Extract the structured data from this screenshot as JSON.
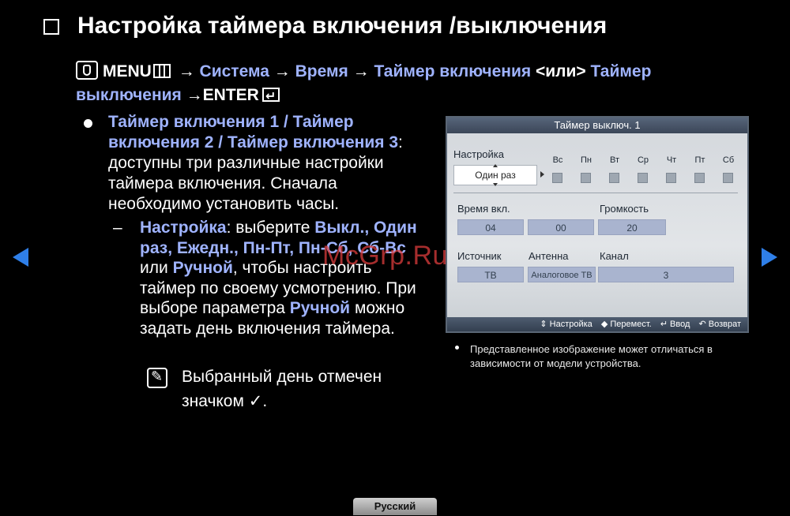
{
  "title": "Настройка таймера включения /выключения",
  "menu_path": {
    "menu": "MENU",
    "arrow": "→",
    "sistema": "Система",
    "vremya": "Время",
    "timer_on": "Таймер включения",
    "ili": "<или>",
    "timer_off_1": "Таймер",
    "timer_off_2": "выключения",
    "enter": "→ENTER"
  },
  "body": {
    "para1_blue": "Таймер включения 1 / Таймер включения 2 / Таймер включения 3",
    "para1_text": ": доступны три различные настройки таймера включения. Сначала необходимо установить часы.",
    "dash": "–",
    "nastroika": "Настройка",
    "vyberite": ": выберите ",
    "options": "Выкл., Один раз, Ежедн., Пн-Пт, Пн-Сб, Сб-Вс",
    "ili": " или ",
    "ruchnoi": "Ручной",
    "chtoby": ", чтобы настроить таймер по своему усмотрению. При выборе параметра ",
    "ruchnoi2": "Ручной",
    "end": " можно задать день включения таймера.",
    "note_1": "Выбранный день отмечен",
    "note_2": "значком ✓."
  },
  "panel": {
    "header": "Таймер выключ. 1",
    "setup_label": "Настройка",
    "setup_value": "Один раз",
    "days": [
      "Вс",
      "Пн",
      "Вт",
      "Ср",
      "Чт",
      "Пт",
      "Сб"
    ],
    "time_label": "Время вкл.",
    "volume_label": "Громкость",
    "hour": "04",
    "minute": "00",
    "volume": "20",
    "source_label": "Источник",
    "antenna_label": "Антенна",
    "channel_label": "Канал",
    "source": "ТВ",
    "antenna": "Аналоговое ТВ",
    "channel": "3",
    "footer": {
      "setup": "⇕ Настройка",
      "move": "◆ Перемест.",
      "enter": "↵ Ввод",
      "back": "↶ Возврат"
    }
  },
  "caption": "Представленное изображение может отличаться в зависимости от модели устройства.",
  "watermark": "McGrp.Ru",
  "language": "Русский",
  "colors": {
    "accent": "#9fb3ff",
    "nav_arrow": "#2f7fe8"
  }
}
